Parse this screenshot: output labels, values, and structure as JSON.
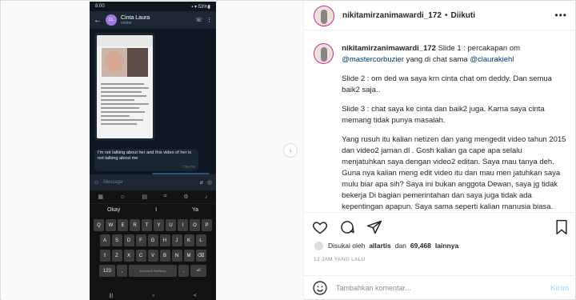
{
  "post": {
    "username": "nikitamirzanimawardi_172",
    "dot": "•",
    "follow_state": "Diikuti",
    "more_label": "•••"
  },
  "caption": {
    "username": "nikitamirzanimawardi_172",
    "intro": "Slide 1 : percakapan om",
    "mention1": "@mastercorbuzier",
    "mid": "yang di chat sama",
    "mention2": "@claurakiehl",
    "p2": "Slide 2 : om ded wa saya krn cinta chat om deddy. Dan semua baik2 saja..",
    "p3": "Slide 3 : chat saya ke cinta dan baik2 juga. Karna saya cinta memang tidak punya masalah.",
    "p4": "Yang rusuh itu kalian netizen dan yang mengedit video tahun 2015 dan video2 jaman dl . Gosh kalian ga cape apa selalu menjatuhkan saya dengan video2 editan. Saya mau tanya deh. Guna nya kalian meng edit video itu dan mau men jatuhkan saya mulu biar apa sih? Saya ini bukan anggota Dewan, saya jg tidak bekerja Di bagian pemerintahan dan saya juga tidak ada kepentingan apapun. Saya sama seperti kalian manusia biasa. Cuma beda nya saya ARTIS itu aja. Belakangan ini saya perhatikan lagi banyak bgt waktu untuk meng"
  },
  "likes": {
    "prefix": "Disukai oleh",
    "user": "allartis",
    "mid": "dan",
    "count": "69,468",
    "suffix": "lainnya"
  },
  "time_ago": "12 JAM YANG LALU",
  "comment": {
    "placeholder": "Tambahkan komentar...",
    "send_label": "Kirim"
  },
  "phone": {
    "status_time": "8:00",
    "status_right": "▪ ▾ 53%▮",
    "chat_initials": "CL",
    "chat_name": "Cinta Laura",
    "chat_status": "online",
    "back_icon": "arrow-left-icon",
    "message_text": "I'm not talking about her and this video of her is not talking about me",
    "message_time": "7:39 PM",
    "input_placeholder": "Message",
    "suggestions": [
      "Okay",
      "I",
      "Ya"
    ],
    "key_row1": [
      "Q",
      "W",
      "E",
      "R",
      "T",
      "Y",
      "U",
      "I",
      "O",
      "P"
    ],
    "key_row2": [
      "A",
      "S",
      "D",
      "F",
      "G",
      "H",
      "J",
      "K",
      "L"
    ],
    "key_row3": [
      "⇧",
      "Z",
      "X",
      "C",
      "V",
      "B",
      "N",
      "M",
      "⌫"
    ],
    "key_row4_left": "123",
    "key_row4_comma": ",",
    "space_label": "Microsoft SwiftKey",
    "key_row4_dot": ".",
    "enter_key": "⏎",
    "nav_buttons": [
      "|||",
      "○",
      "<"
    ]
  },
  "colors": {
    "text": "#262626",
    "secondary": "#8e8e8e",
    "mention": "#00376b",
    "send_disabled": "#b2dffc",
    "phone_bg": "#0e1621"
  }
}
